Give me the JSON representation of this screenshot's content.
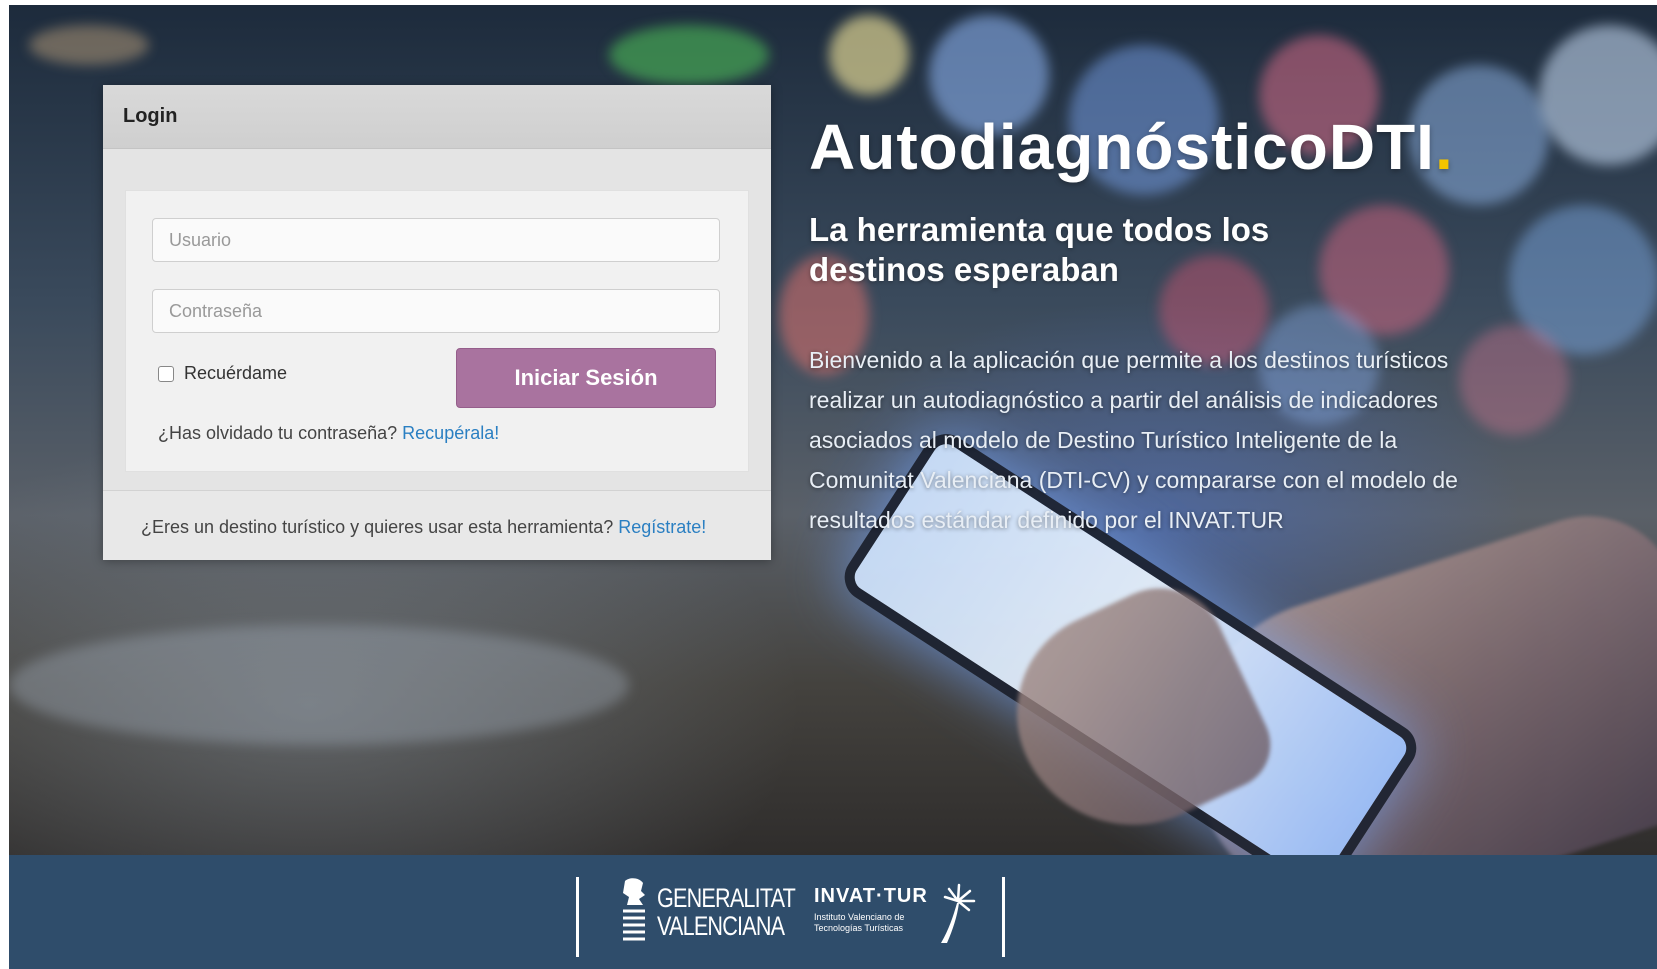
{
  "login": {
    "title": "Login",
    "username_placeholder": "Usuario",
    "password_placeholder": "Contraseña",
    "remember_label": "Recuérdame",
    "submit_label": "Iniciar Sesión",
    "forgot_text": "¿Has olvidado tu contraseña?",
    "forgot_link": "Recupérala!",
    "register_text": "¿Eres un destino turístico y quieres usar esta herramienta?",
    "register_link": "Regístrate!"
  },
  "hero": {
    "brand": "AutodiagnósticoDTI",
    "brand_dot": ".",
    "tagline": "La herramienta que todos los destinos esperaban",
    "intro": "Bienvenido a la aplicación que permite a los destinos turísticos realizar un autodiagnóstico a partir del análisis de indicadores asociados al modelo de Destino Turístico Inteligente de la Comunitat Valenciana (DTI-CV) y compararse con el modelo de resultados estándar definido por el INVAT.TUR"
  },
  "footer": {
    "gv_line1": "GENERALITAT",
    "gv_line2": "VALENCIANA",
    "invat_title": "INVAT·TUR",
    "invat_sub1": "Instituto Valenciano de",
    "invat_sub2": "Tecnologías Turísticas"
  },
  "colors": {
    "accent_button": "#a9739f",
    "brand_dot": "#f2c400",
    "footer_bg": "#2f4d6b",
    "link": "#2a7fc2"
  }
}
